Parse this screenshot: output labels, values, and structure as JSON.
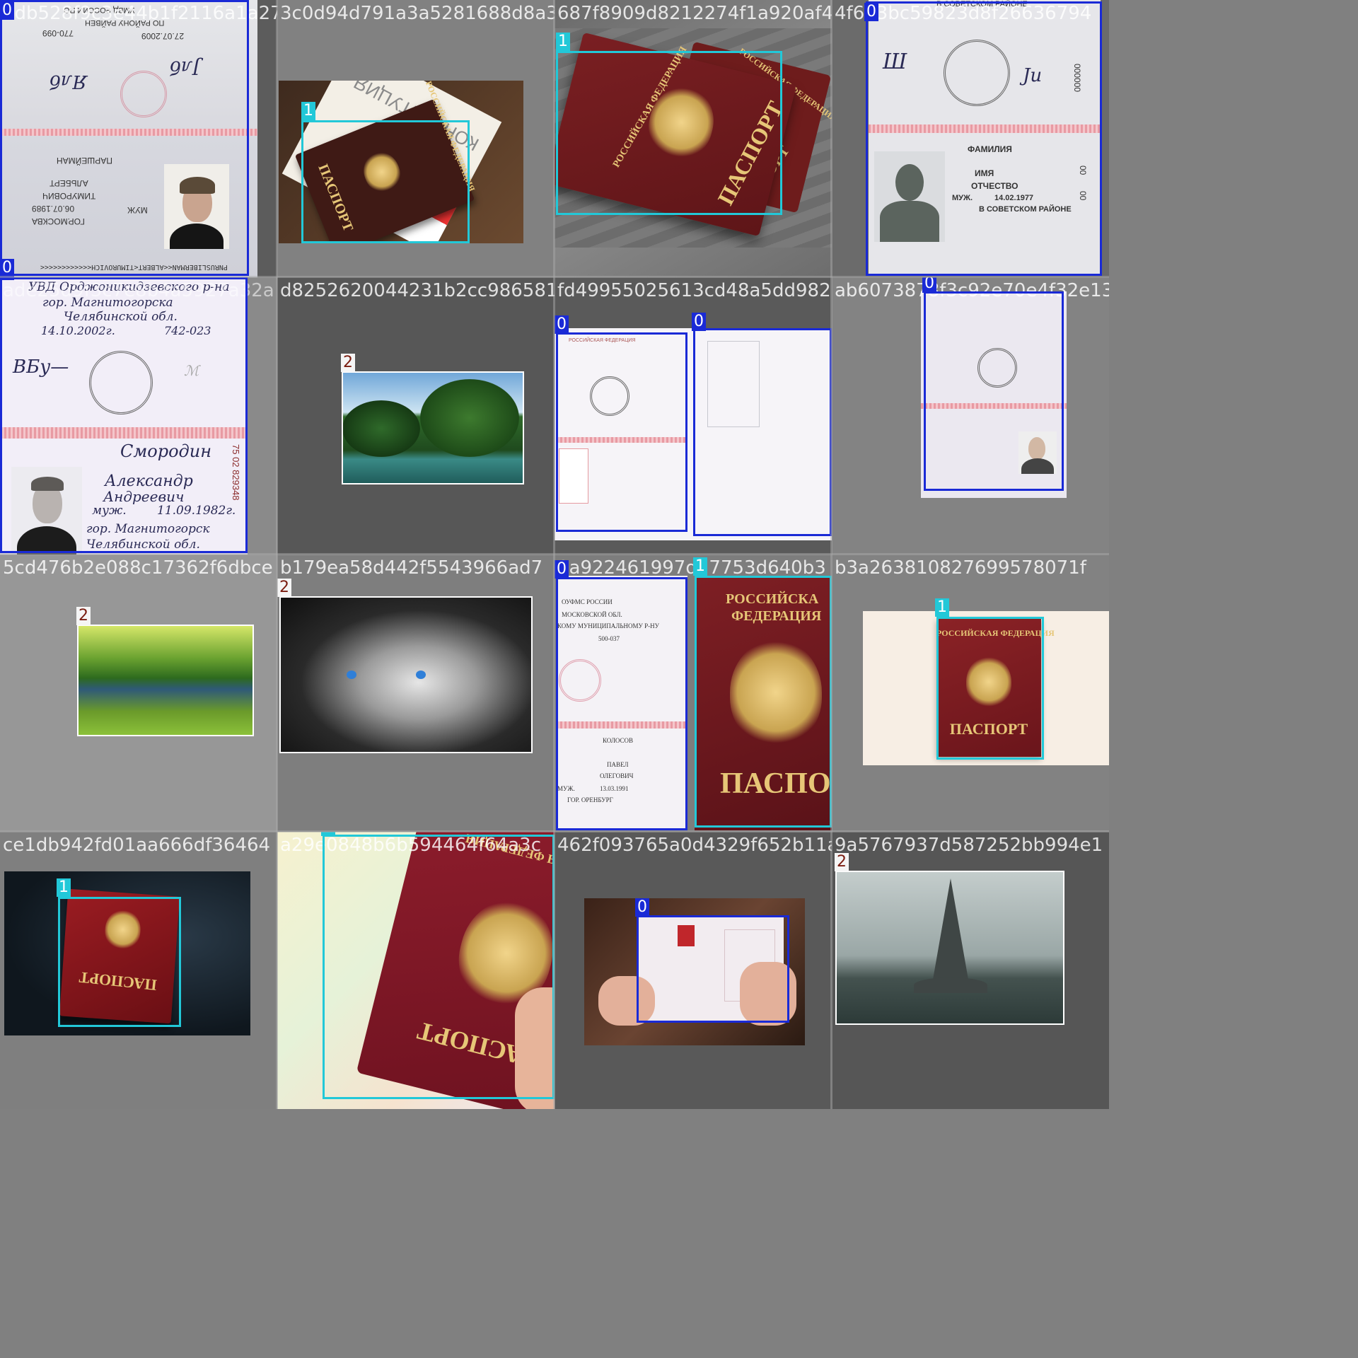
{
  "mosaic": {
    "tiles": [
      {
        "hash": "6db528f9c3e44b1f2116a1a27",
        "labels": [
          "0",
          "0"
        ]
      },
      {
        "hash": "3c0d94d791a3a5281688d8a356",
        "labels": [
          "1"
        ]
      },
      {
        "hash": "687f8909d8212274f1a920af4c",
        "labels": [
          "1"
        ]
      },
      {
        "hash": "4f6d3bc59823d8f26636794",
        "labels": [
          "0"
        ]
      },
      {
        "hash": "ade25d9f3c7e8b4a5927a32a",
        "labels": [
          "0"
        ]
      },
      {
        "hash": "d8252620044231b2cc986581",
        "labels": [
          "2"
        ]
      },
      {
        "hash": "fd49955025613cd48a5dd982",
        "labels": [
          "0",
          "0"
        ]
      },
      {
        "hash": "ab6073878f3c92e70e4f32e13c8",
        "labels": [
          "0"
        ]
      },
      {
        "hash": "5cd476b2e088c17362f6dbce",
        "labels": [
          "2"
        ]
      },
      {
        "hash": "b179ea58d442f5543966ad7",
        "labels": [
          "2"
        ]
      },
      {
        "hash": "0a922461997d17753d640b3",
        "labels": [
          "0",
          "1"
        ]
      },
      {
        "hash": "b3a263810827699578071f",
        "labels": [
          "1"
        ]
      },
      {
        "hash": "ce1db942fd01aa666df36464",
        "labels": [
          "1"
        ]
      },
      {
        "hash": "a29e0848b6b594464f64a3c",
        "labels": [
          "1"
        ]
      },
      {
        "hash": "462f093765a0d4329f652b11a",
        "labels": [
          "0"
        ]
      },
      {
        "hash": "9a5767937d587252bb994e1",
        "labels": [
          "2"
        ]
      }
    ],
    "doc_text": {
      "t1_top": [
        "УМВД РОССИИ ПО",
        "ПО РАЙОНУ РАЙВЕН",
        "770-099",
        "27.07.2009"
      ],
      "t1_bottom": [
        "ПАРШЕЙМАН",
        "АЛЬБЕРТ",
        "ТИМУРОВИЧ",
        "06.07.1989",
        "МУЖ",
        "ГОР.МОСКВА",
        "PNRUSLIBERMAN<<ALBERT<TIMUROVICH<<<<<<<<<<<<"
      ],
      "t4": [
        "В СОВЕТСКОМ РАЙОНЕ",
        "ФАМИЛИЯ",
        "ИМЯ",
        "ОТЧЕСТВО",
        "МУЖ.",
        "14.02.1977",
        "В СОВЕТСКОМ РАЙОНЕ",
        "000000",
        "00",
        "00"
      ],
      "t5": [
        "УВД Орджоникидзевского р-на",
        "гор. Магнитогорска",
        "Челябинской обл.",
        "14.10.2002г.",
        "742-023",
        "Смородин",
        "Александр",
        "Андреевич",
        "муж.",
        "11.09.1982г.",
        "гор. Магнитогорск",
        "Челябинской обл.",
        "75 02 829348"
      ],
      "t7_left": "РОССИЙСКАЯ ФЕДЕРАЦИЯ",
      "t11_left": [
        "ОУФМС РОССИИ",
        "МОСКОВСКОЙ ОБЛ.",
        "КОМУ МУНИЦИПАЛЬНОМУ Р-НУ",
        "500-037",
        "КОЛОСОВ",
        "ПАВЕЛ",
        "ОЛЕГОВИЧ",
        "МУЖ.",
        "13.03.1991",
        "ГОР. ОРЕНБУРГ"
      ],
      "cover_ru": "РОССИЙСКАЯ ФЕДЕРАЦИЯ",
      "cover_title": "ПАСПОРТ",
      "t11_right_a": "РОССИЙСКА",
      "t11_right_b": "ФЕДЕРАЦИЯ",
      "t11_right_title": "ПАСПОР",
      "t14_title": "ПАСПОРТ",
      "book_text": "КОНСТИТУЦИЯ"
    }
  },
  "colors": {
    "class0": "#1a2ad6",
    "class1": "#22c8d8",
    "class2": "#ffffff",
    "passport_red": "#7a1c24",
    "gold": "#e6c677"
  }
}
